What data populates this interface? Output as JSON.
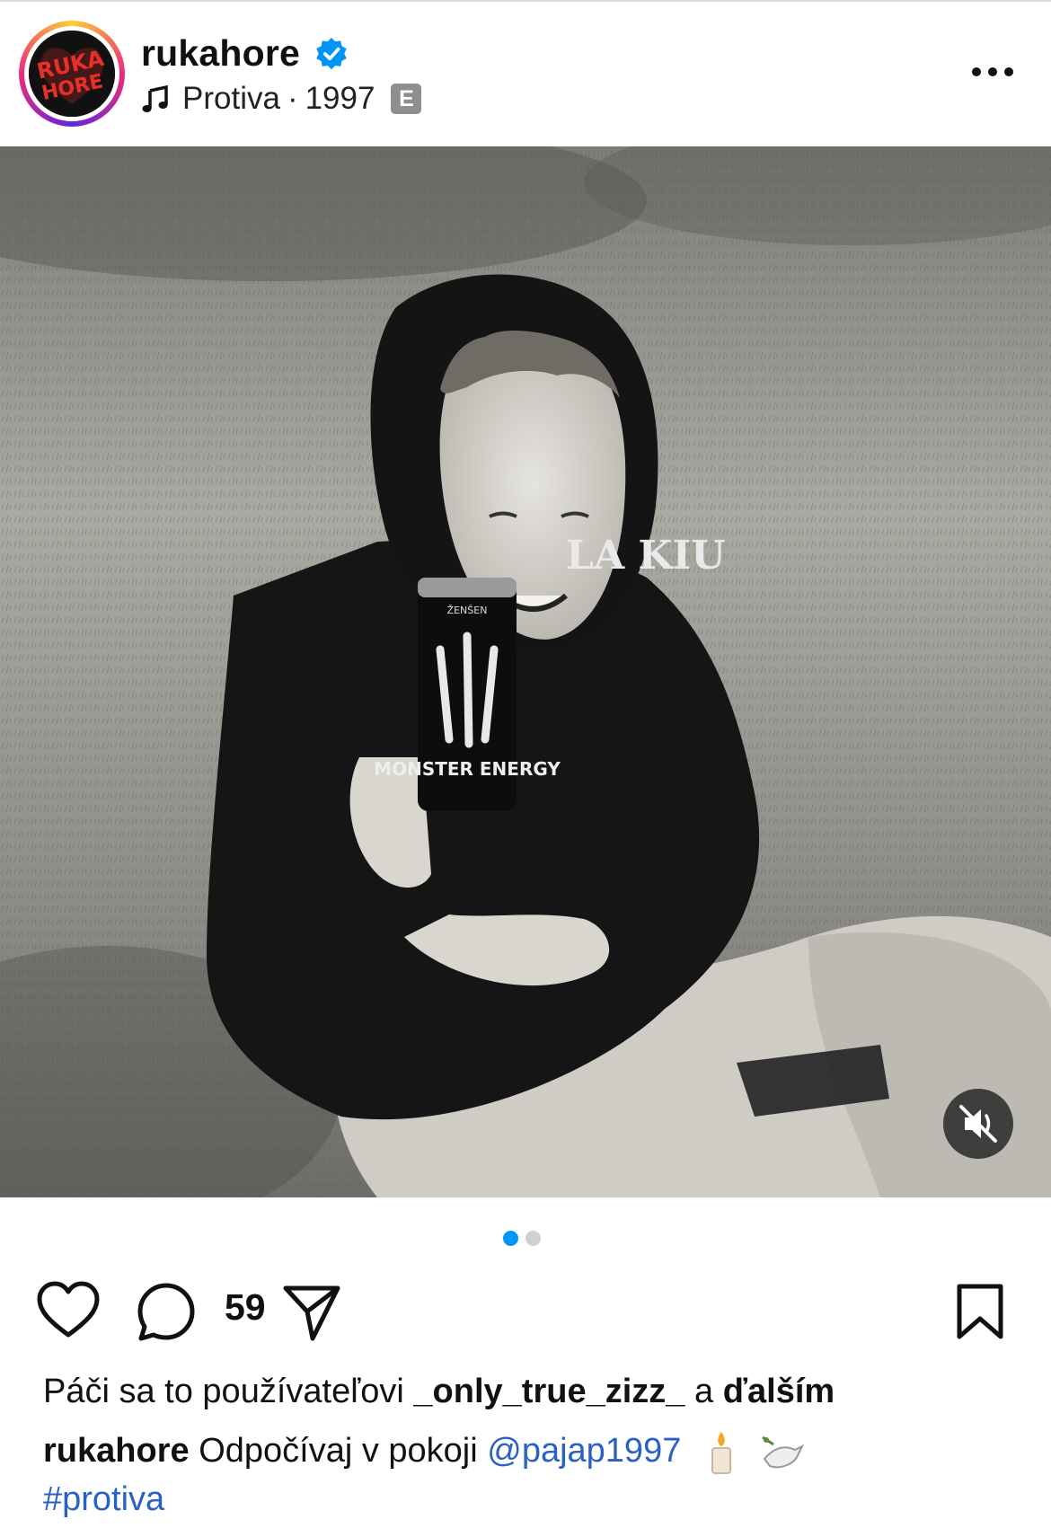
{
  "header": {
    "username": "rukahore",
    "avatar_text": "RUKA HORE",
    "song_title": "Protiva",
    "song_separator": "·",
    "song_year": "1997",
    "explicit_badge": "E"
  },
  "post": {
    "image_description_icon": "photo",
    "can_brand_text": "MONSTER ENERGY",
    "can_top_text": "ŽENŠEN",
    "hoodie_text": "LA KIU",
    "carousel": {
      "total": 2,
      "active": 1
    }
  },
  "actions": {
    "comment_count": "59"
  },
  "likes": {
    "prefix": "Páči sa to používateľovi",
    "user": "_only_true_zizz_",
    "middle": "a",
    "others": "ďalším"
  },
  "caption": {
    "username": "rukahore",
    "text": "Odpočívaj v pokoji",
    "mention": "@pajap1997",
    "emojis": [
      "candle-icon",
      "dove-icon"
    ],
    "hashtag": "#protiva"
  },
  "colors": {
    "link": "#2a61c7",
    "verified": "#0095f6",
    "active_dot": "#0095f6",
    "avatar_text": "#e8302a"
  }
}
